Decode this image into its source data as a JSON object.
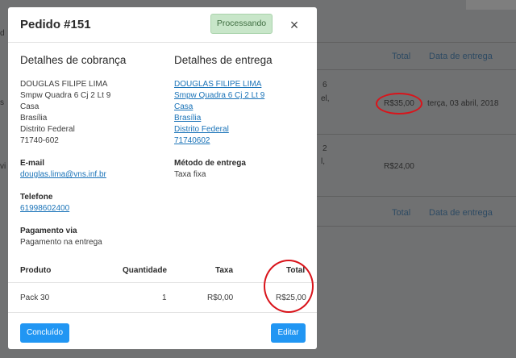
{
  "modal": {
    "title": "Pedido #151",
    "status": "Processando",
    "close_symbol": "×"
  },
  "billing": {
    "heading": "Detalhes de cobrança",
    "address": [
      "DOUGLAS FILIPE LIMA",
      "Smpw Quadra 6 Cj 2 Lt 9",
      "Casa",
      "Brasília",
      "Distrito Federal",
      "71740-602"
    ],
    "email_label": "E-mail",
    "email": "douglas.lima@vns.inf.br",
    "phone_label": "Telefone",
    "phone": "61998602400",
    "payment_label": "Pagamento via",
    "payment": "Pagamento na entrega"
  },
  "shipping": {
    "heading": "Detalhes de entrega",
    "address": [
      "DOUGLAS FILIPE LIMA",
      "Smpw Quadra 6 Cj 2 Lt 9",
      "Casa",
      "Brasília",
      "Distrito Federal",
      "71740602"
    ],
    "method_label": "Método de entrega",
    "method": "Taxa fixa"
  },
  "table": {
    "headers": {
      "product": "Produto",
      "quantity": "Quantidade",
      "tax": "Taxa",
      "total": "Total"
    },
    "rows": [
      {
        "product": "Pack 30",
        "quantity": "1",
        "tax": "R$0,00",
        "total": "R$25,00"
      }
    ]
  },
  "footer": {
    "complete_label": "Concluído",
    "edit_label": "Editar"
  },
  "background": {
    "col_total": "Total",
    "col_date": "Data de entrega",
    "fragment_1": "6",
    "fragment_2": "el,",
    "fragment_3": "2",
    "fragment_4": "l,",
    "left_fragment_1": "s",
    "left_fragment_2": "vi",
    "row1_total": "R$35,00",
    "row1_date": "terça, 03 abril, 2018",
    "row2_total": "R$24,00",
    "footer_total": "Total",
    "footer_date": "Data de entrega",
    "side_fragment": "d"
  },
  "colors": {
    "primary": "#2196f3",
    "status_bg": "#c8e6c9",
    "link": "#1a73b8",
    "annotation_red": "#d9141b"
  }
}
